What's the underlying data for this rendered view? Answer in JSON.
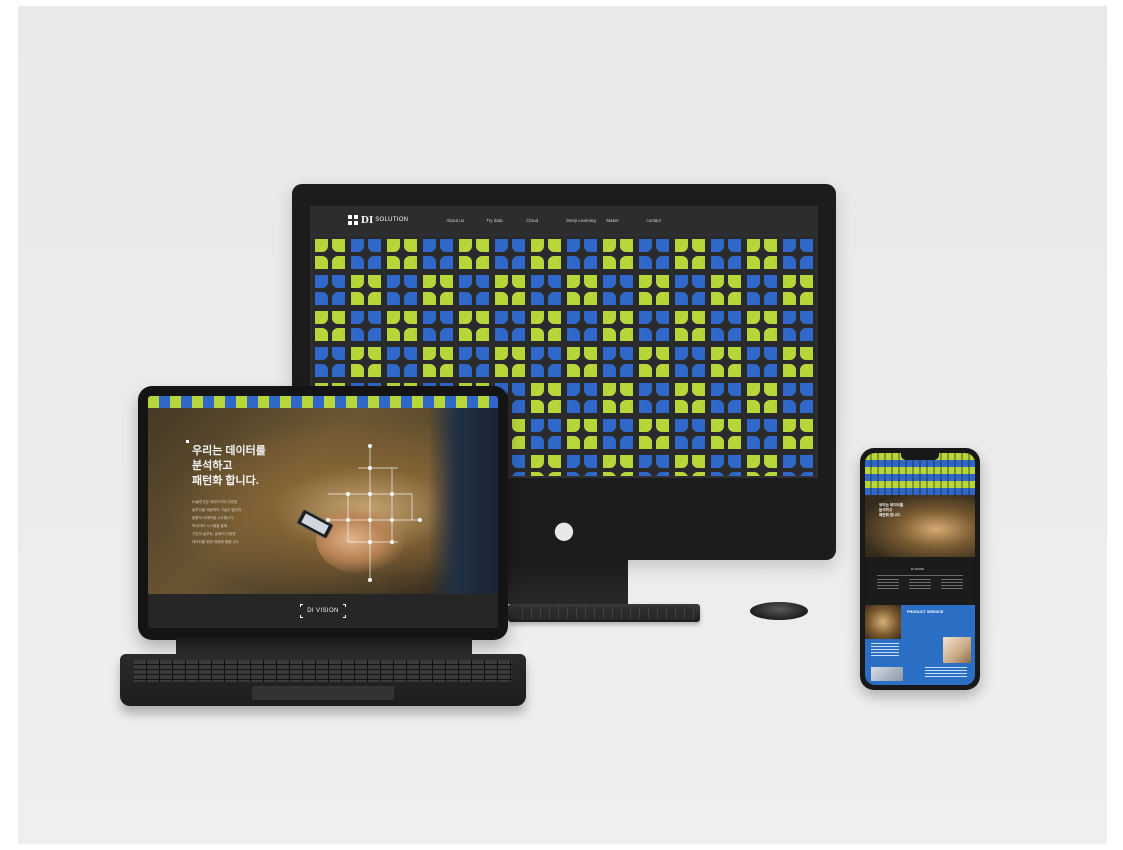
{
  "imac": {
    "brand": {
      "di": "DI",
      "solution": "SOLUTION"
    },
    "nav": [
      "About us",
      "Try data",
      "Cloud",
      "Deep Learning",
      "Maker",
      "contact"
    ],
    "colors": {
      "green": "#b7d63a",
      "blue": "#2f68c8",
      "dark": "#2d2d2f"
    }
  },
  "ipad": {
    "heading": "우리는 데이터를\n분석하고\n패턴화 합니다.",
    "body_lines": [
      "DI솔루션은 데이터가의 다양한",
      "솔루션을 제공하여 기술이 발전과",
      "통합적 이해력을 시도합니다.",
      "빅데이터 시스템을 통해",
      "기업의 솔루트, 분배의 다양한",
      "데이터를 위한 대용화 원합니다."
    ],
    "footer_label": "DI VISION"
  },
  "iphone": {
    "hero_text": "우리는 데이터를\n분석하고\n패턴화 합니다.",
    "section_title": "DI VISION",
    "product_label": "PRODUCT SERVICE"
  }
}
